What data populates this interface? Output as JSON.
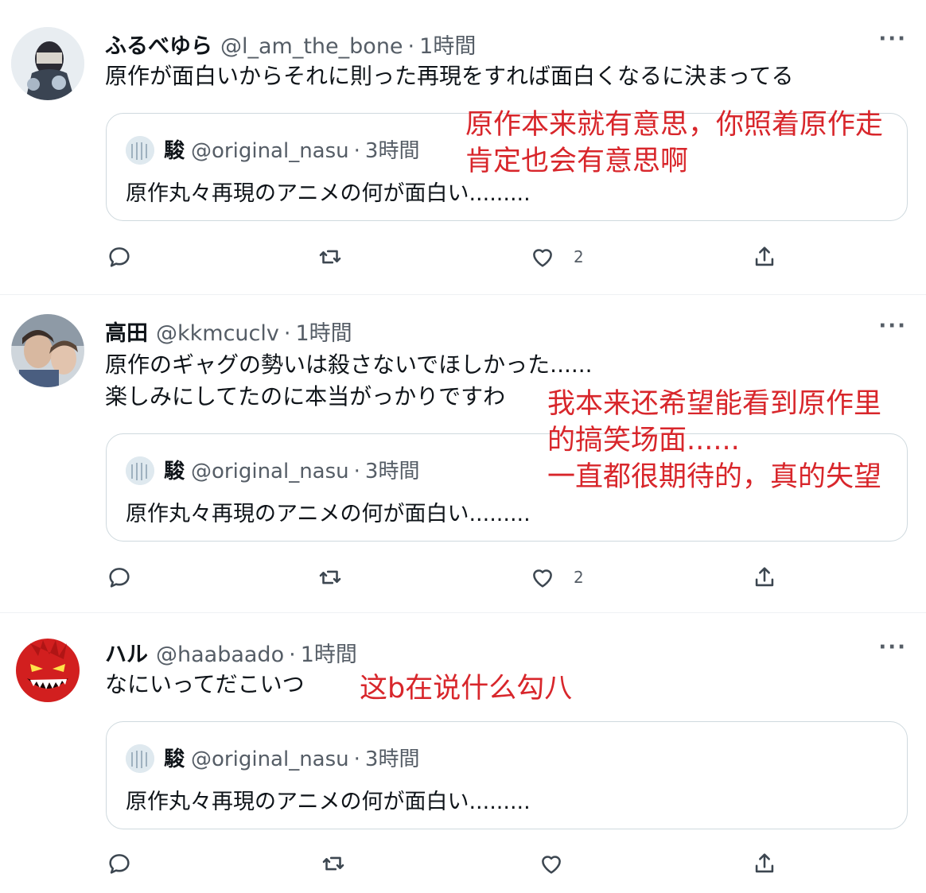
{
  "tweets": [
    {
      "name": "ふるべゆら",
      "handle": "@l_am_the_bone",
      "time": "1時間",
      "lines": [
        "原作が面白いからそれに則った再現をすれば面白くなるに決まってる"
      ],
      "quote": {
        "name": "駿",
        "handle": "@original_nasu",
        "time": "3時間",
        "text": "原作丸々再現のアニメの何が面白い........."
      },
      "actions": {
        "reply": "",
        "retweet": "",
        "like": "2",
        "share": ""
      },
      "annotation": [
        "原作本来就有意思，你照着原作走",
        "肯定也会有意思啊"
      ]
    },
    {
      "name": "高田",
      "handle": "@kkmcuclv",
      "time": "1時間",
      "lines": [
        "原作のギャグの勢いは殺さないでほしかった......",
        "楽しみにしてたのに本当がっかりですわ"
      ],
      "quote": {
        "name": "駿",
        "handle": "@original_nasu",
        "time": "3時間",
        "text": "原作丸々再現のアニメの何が面白い........."
      },
      "actions": {
        "reply": "",
        "retweet": "",
        "like": "2",
        "share": ""
      },
      "annotation": [
        "我本来还希望能看到原作里",
        "的搞笑场面......",
        "一直都很期待的，真的失望"
      ]
    },
    {
      "name": "ハル",
      "handle": "@haabaado",
      "time": "1時間",
      "lines": [
        "なにいってだこいつ"
      ],
      "quote": {
        "name": "駿",
        "handle": "@original_nasu",
        "time": "3時間",
        "text": "原作丸々再現のアニメの何が面白い........."
      },
      "actions": {
        "reply": "",
        "retweet": "",
        "like": "",
        "share": ""
      },
      "annotation": [
        "这b在说什么勾八"
      ]
    }
  ],
  "icons": {
    "more": "more-icon",
    "reply": "reply-icon",
    "retweet": "retweet-icon",
    "like": "like-icon",
    "share": "share-icon"
  },
  "colors": {
    "annotation": "#d8262b",
    "secondary_text": "#555d66",
    "quote_border": "#cfd9de"
  }
}
